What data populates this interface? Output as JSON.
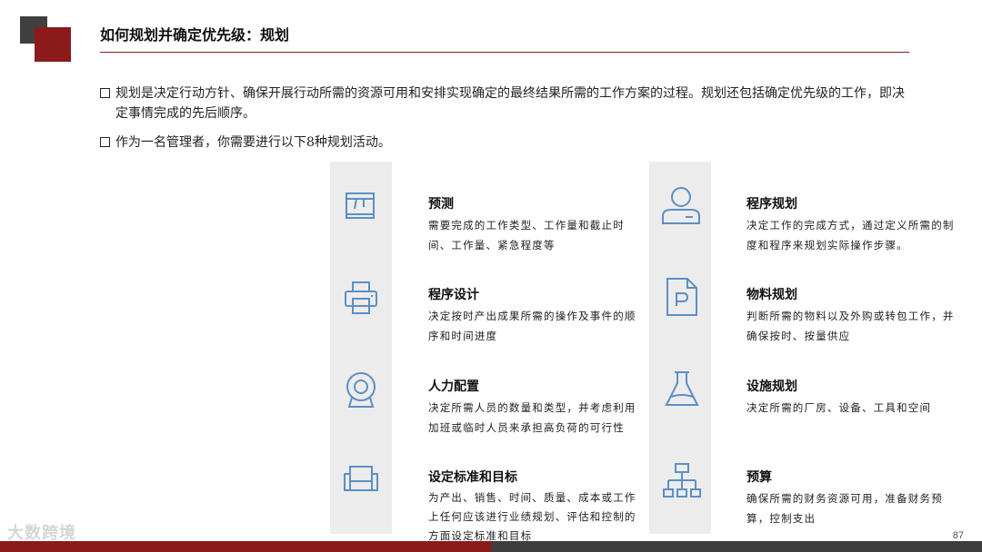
{
  "header": {
    "title": "如何规划并确定优先级：规划"
  },
  "bullets": [
    "规划是决定行动方针、确保开展行动所需的资源可用和安排实现确定的最终结果所需的工作方案的过程。规划还包括确定优先级的工作，即决定事情完成的先后顺序。",
    "作为一名管理者，你需要进行以下8种规划活动。"
  ],
  "activities": [
    {
      "title": "预测",
      "desc": "需要完成的工作类型、工作量和截止时间、工作量、紧急程度等",
      "icon": "calendar-icon"
    },
    {
      "title": "程序设计",
      "desc": "决定按时产出成果所需的操作及事件的顺序和时间进度",
      "icon": "printer-icon"
    },
    {
      "title": "人力配置",
      "desc": "决定所需人员的数量和类型，并考虑利用加班或临时人员来承担高负荷的可行性",
      "icon": "webcam-icon"
    },
    {
      "title": "设定标准和目标",
      "desc": "为产出、销售、时间、质量、成本或工作上任何应该进行业绩规划、评估和控制的方面设定标准和目标",
      "icon": "sofa-icon"
    },
    {
      "title": "程序规划",
      "desc": "决定工作的完成方式，通过定义所需的制度和程序来规划实际操作步骤。",
      "icon": "user-icon"
    },
    {
      "title": "物料规划",
      "desc": "判断所需的物料以及外购或转包工作，并确保按时、按量供应",
      "icon": "document-p-icon"
    },
    {
      "title": "设施规划",
      "desc": "决定所需的厂房、设备、工具和空间",
      "icon": "flask-icon"
    },
    {
      "title": "预算",
      "desc": "确保所需的财务资源可用，准备财务预算，控制支出",
      "icon": "org-chart-icon"
    }
  ],
  "footer": {
    "page_number": "87",
    "watermark": "大数跨境"
  },
  "colors": {
    "accent": "#8c1a1a",
    "icon": "#5b8fc6",
    "column_bg": "#ececec"
  }
}
